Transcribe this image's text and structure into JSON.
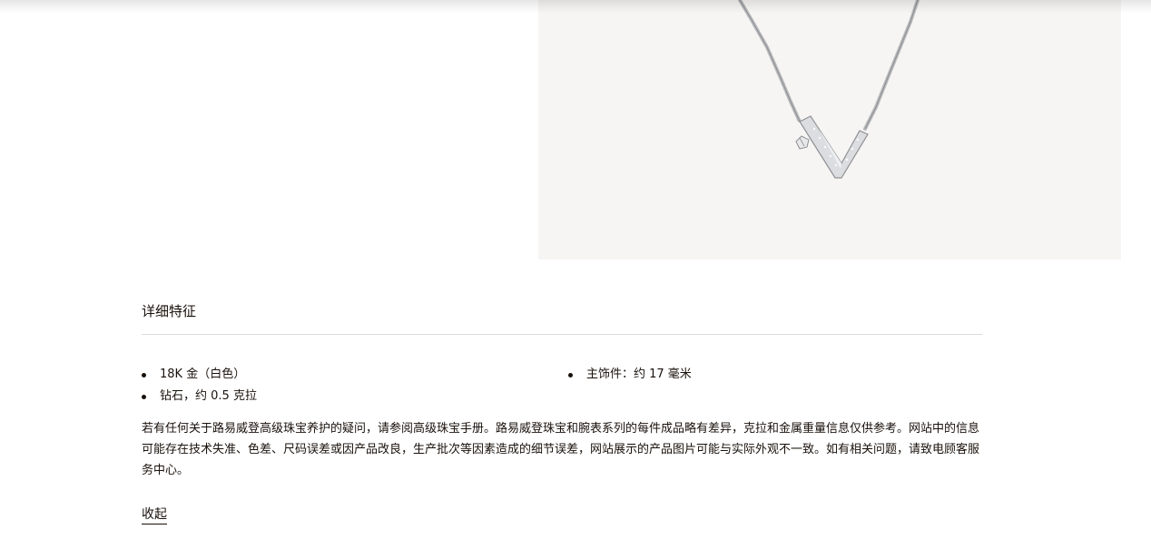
{
  "product": {
    "image_alt": "项链"
  },
  "details": {
    "title": "详细特征",
    "features_left": [
      "18K 金（白色）",
      "钻石，约 0.5 克拉"
    ],
    "features_right": [
      "主饰件：约 17 毫米"
    ],
    "notice": "若有任何关于路易威登高级珠宝养护的疑问，请参阅高级珠宝手册。路易威登珠宝和腕表系列的每件成品略有差异，克拉和金属重量信息仅供参考。网站中的信息可能存在技术失准、色差、尺码误差或因产品改良，生产批次等因素造成的细节误差，网站展示的产品图片可能与实际外观不一致。如有相关问题，请致电顾客服务中心。",
    "collapse_label": "收起"
  },
  "colors": {
    "text": "#19110b",
    "image_background": "#f6f5f3",
    "divider": "#dcdcdc"
  }
}
